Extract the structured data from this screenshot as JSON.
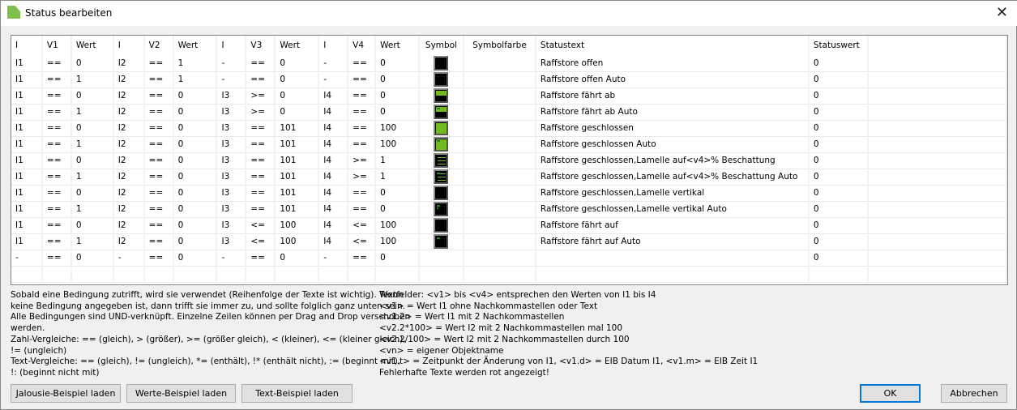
{
  "window": {
    "title": "Status bearbeiten"
  },
  "table": {
    "headers": [
      "I",
      "V1",
      "Wert",
      "I",
      "V2",
      "Wert",
      "I",
      "V3",
      "Wert",
      "I",
      "V4",
      "Wert",
      "Symbol",
      "Symbolfarbe",
      "Statustext",
      "Statuswert",
      ""
    ],
    "rows": [
      {
        "c": [
          "I1",
          "==",
          "0",
          "I2",
          "==",
          "1",
          "-",
          "==",
          "0",
          "-",
          "==",
          "0"
        ],
        "symbol": "blind-open-icon",
        "text": "Raffstore offen",
        "value": "0"
      },
      {
        "c": [
          "I1",
          "==",
          "1",
          "I2",
          "==",
          "1",
          "-",
          "==",
          "0",
          "-",
          "==",
          "0"
        ],
        "symbol": "blind-open-icon",
        "text": "Raffstore offen Auto",
        "value": "0"
      },
      {
        "c": [
          "I1",
          "==",
          "0",
          "I2",
          "==",
          "0",
          "I3",
          ">=",
          "0",
          "I4",
          "==",
          "0"
        ],
        "symbol": "blind-half-icon",
        "text": "Raffstore fährt ab",
        "value": "0"
      },
      {
        "c": [
          "I1",
          "==",
          "1",
          "I2",
          "==",
          "0",
          "I3",
          ">=",
          "0",
          "I4",
          "==",
          "0"
        ],
        "symbol": "blind-half-auto-icon",
        "text": "Raffstore fährt ab Auto",
        "value": "0"
      },
      {
        "c": [
          "I1",
          "==",
          "0",
          "I2",
          "==",
          "0",
          "I3",
          "==",
          "101",
          "I4",
          "==",
          "100"
        ],
        "symbol": "blind-closed-icon",
        "text": "Raffstore geschlossen",
        "value": "0"
      },
      {
        "c": [
          "I1",
          "==",
          "1",
          "I2",
          "==",
          "0",
          "I3",
          "==",
          "101",
          "I4",
          "==",
          "100"
        ],
        "symbol": "blind-closed-auto-icon",
        "text": "Raffstore geschlossen Auto",
        "value": "0"
      },
      {
        "c": [
          "I1",
          "==",
          "0",
          "I2",
          "==",
          "0",
          "I3",
          "==",
          "101",
          "I4",
          ">=",
          "1"
        ],
        "symbol": "blind-slats-icon",
        "text": "Raffstore geschlossen,Lamelle auf<v4>% Beschattung",
        "value": "0"
      },
      {
        "c": [
          "I1",
          "==",
          "1",
          "I2",
          "==",
          "0",
          "I3",
          "==",
          "101",
          "I4",
          ">=",
          "1"
        ],
        "symbol": "blind-slats-auto-icon",
        "text": "Raffstore geschlossen,Lamelle auf<v4>% Beschattung Auto",
        "value": "0"
      },
      {
        "c": [
          "I1",
          "==",
          "0",
          "I2",
          "==",
          "0",
          "I3",
          "==",
          "101",
          "I4",
          "==",
          "0"
        ],
        "symbol": "blind-open-icon",
        "text": "Raffstore geschlossen,Lamelle vertikal",
        "value": "0"
      },
      {
        "c": [
          "I1",
          "==",
          "1",
          "I2",
          "==",
          "0",
          "I3",
          "==",
          "101",
          "I4",
          "==",
          "0"
        ],
        "symbol": "blind-vertical-auto-icon",
        "text": "Raffstore geschlossen,Lamelle vertikal Auto",
        "value": "0"
      },
      {
        "c": [
          "I1",
          "==",
          "0",
          "I2",
          "==",
          "0",
          "I3",
          "<=",
          "100",
          "I4",
          "<=",
          "100"
        ],
        "symbol": "blind-open-icon",
        "text": "Raffstore fährt auf",
        "value": "0"
      },
      {
        "c": [
          "I1",
          "==",
          "1",
          "I2",
          "==",
          "0",
          "I3",
          "<=",
          "100",
          "I4",
          "<=",
          "100"
        ],
        "symbol": "blind-up-auto-icon",
        "text": "Raffstore fährt auf Auto",
        "value": "0"
      },
      {
        "c": [
          "-",
          "==",
          "0",
          "-",
          "==",
          "0",
          "-",
          "==",
          "0",
          "-",
          "==",
          "0"
        ],
        "symbol": "",
        "text": "",
        "value": "0"
      }
    ]
  },
  "help_left": "Sobald eine Bedingung zutrifft, wird sie verwendet (Reihenfolge der Texte ist wichtig). Wenn\nkeine Bedingung angegeben ist, dann trifft sie immer zu, und sollte folglich ganz unten sein.\nAlle Bedingungen sind UND-verknüpft. Einzelne Zeilen können per Drag and Drop verschoben\nwerden.\nZahl-Vergleiche: == (gleich), > (größer), >= (größer gleich), < (kleiner), <= (kleiner gleich),\n!= (ungleich)\nText-Vergleiche: == (gleich), != (ungleich), *= (enthält), !* (enthält nicht), := (beginnt mit),\n!: (beginnt nicht mit)",
  "help_right": "Textfelder: <v1> bis <v4> entsprechen den Werten von I1 bis I4\n<v1> = Wert I1 ohne Nachkommastellen oder Text\n<v1.2> = Wert I1 mit 2 Nachkommastellen\n<v2.2*100> = Wert I2 mit 2 Nachkommastellen mal 100\n<v2.2/100> = Wert I2 mit 2 Nachkommastellen durch 100\n<vn> = eigener Objektname\n<v1.t> = Zeitpunkt der Änderung von I1, <v1.d> = EIB Datum I1, <v1.m> = EIB Zeit I1\nFehlerhafte Texte werden rot angezeigt!",
  "buttons": {
    "jalousie": "Jalousie-Beispiel laden",
    "werte": "Werte-Beispiel laden",
    "text": "Text-Beispiel laden",
    "ok": "OK",
    "cancel": "Abbrechen"
  },
  "colors": {
    "symbol_green": "#74b822"
  }
}
